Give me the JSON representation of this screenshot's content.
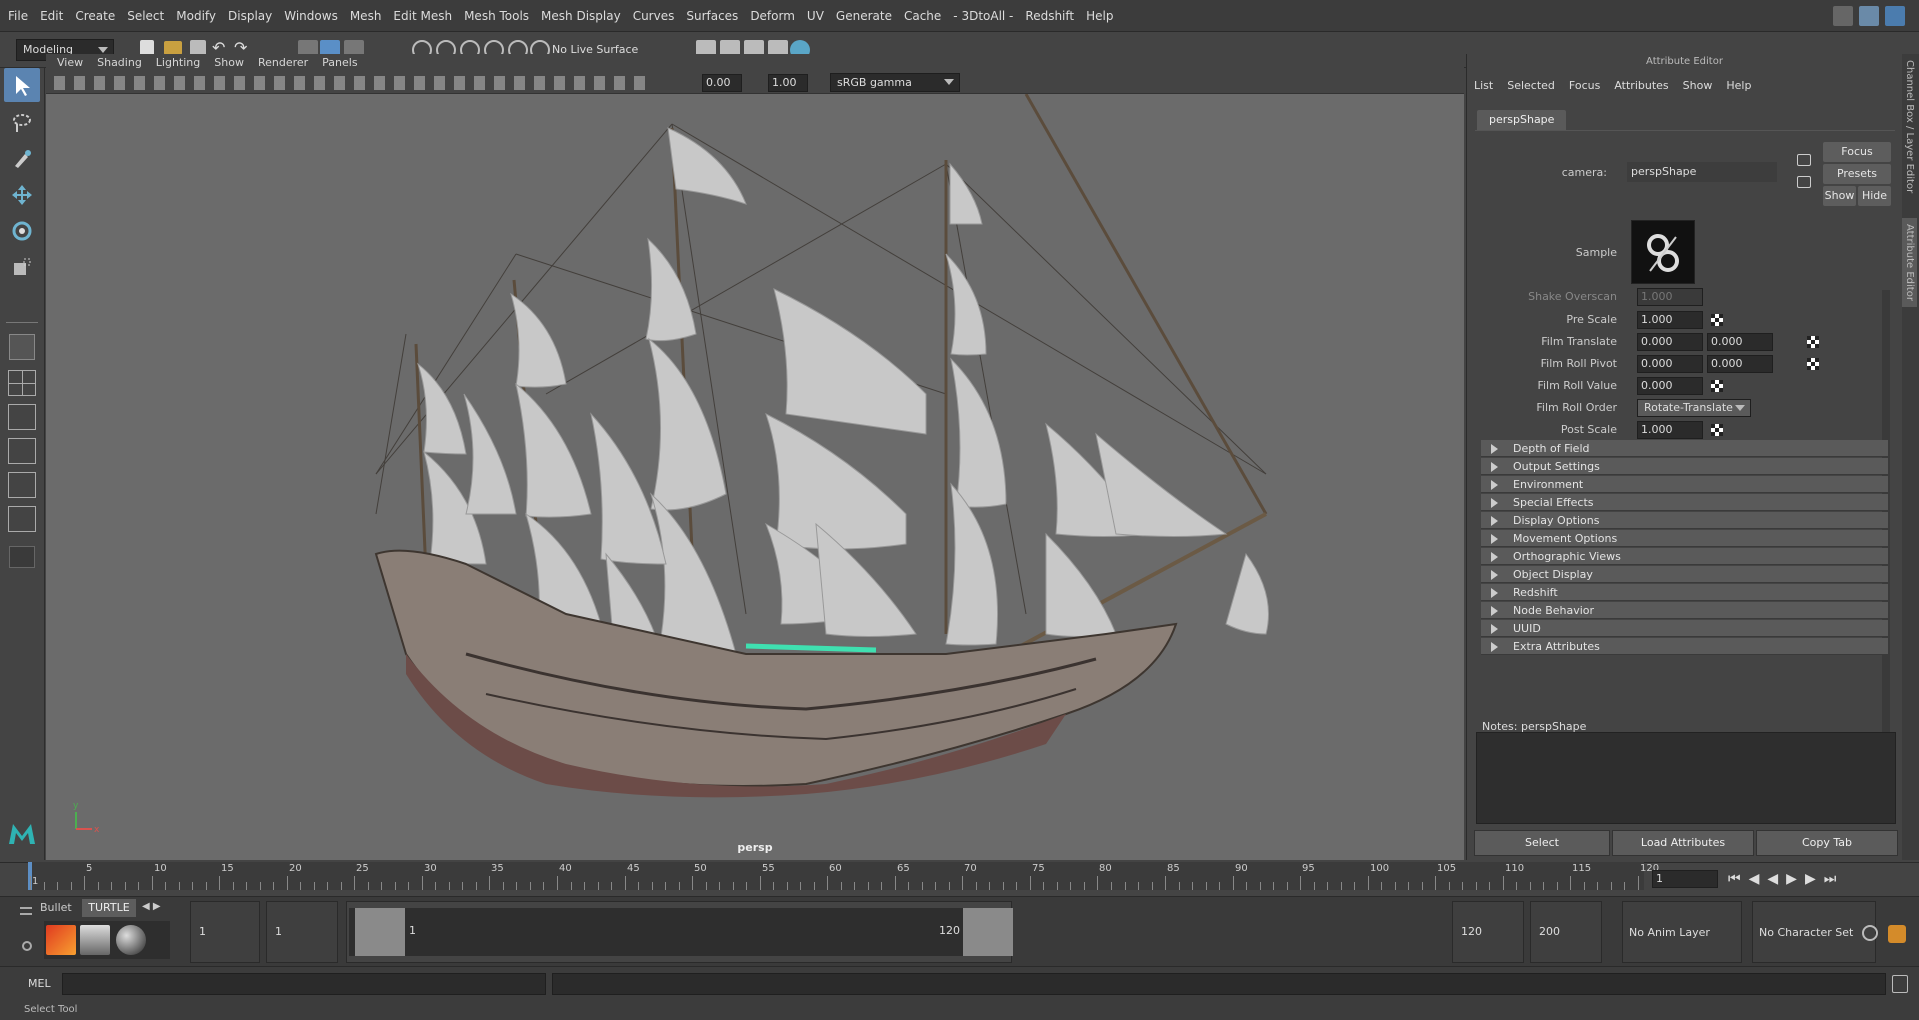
{
  "menubar": {
    "items": [
      "File",
      "Edit",
      "Create",
      "Select",
      "Modify",
      "Display",
      "Windows",
      "Mesh",
      "Edit Mesh",
      "Mesh Tools",
      "Mesh Display",
      "Curves",
      "Surfaces",
      "Deform",
      "UV",
      "Generate",
      "Cache",
      "- 3DtoAll -",
      "Redshift",
      "Help"
    ]
  },
  "shelf": {
    "mode": "Modeling",
    "live_surface": "No Live Surface"
  },
  "viewport": {
    "menus": [
      "View",
      "Shading",
      "Lighting",
      "Show",
      "Renderer",
      "Panels"
    ],
    "field_a": "0.00",
    "field_b": "1.00",
    "colorspace": "sRGB gamma",
    "camera_label": "persp",
    "axis_y": "y",
    "axis_x": "x"
  },
  "attr_editor": {
    "title": "Attribute Editor",
    "menus": [
      "List",
      "Selected",
      "Focus",
      "Attributes",
      "Show",
      "Help"
    ],
    "tab": "perspShape",
    "camera_label": "camera:",
    "camera_value": "perspShape",
    "focus": "Focus",
    "presets": "Presets",
    "show": "Show",
    "hide": "Hide",
    "sample_label": "Sample",
    "shake_overscan_label": "Shake Overscan",
    "shake_overscan": "1.000",
    "pre_scale_label": "Pre Scale",
    "pre_scale": "1.000",
    "film_translate_label": "Film Translate",
    "film_translate_x": "0.000",
    "film_translate_y": "0.000",
    "film_roll_pivot_label": "Film Roll Pivot",
    "film_roll_pivot_x": "0.000",
    "film_roll_pivot_y": "0.000",
    "film_roll_value_label": "Film Roll Value",
    "film_roll_value": "0.000",
    "film_roll_order_label": "Film Roll Order",
    "film_roll_order": "Rotate-Translate",
    "post_scale_label": "Post Scale",
    "post_scale": "1.000",
    "sections": [
      "Depth of Field",
      "Output Settings",
      "Environment",
      "Special Effects",
      "Display Options",
      "Movement Options",
      "Orthographic Views",
      "Object Display",
      "Redshift",
      "Node Behavior",
      "UUID",
      "Extra Attributes"
    ],
    "notes_label": "Notes:  perspShape",
    "buttons": {
      "select": "Select",
      "load": "Load Attributes",
      "copy": "Copy Tab"
    },
    "side_tabs": {
      "channel": "Channel Box / Layer Editor",
      "attr": "Attribute Editor"
    }
  },
  "timeline": {
    "ticks": [
      "1",
      "5",
      "10",
      "15",
      "20",
      "25",
      "30",
      "35",
      "40",
      "45",
      "50",
      "55",
      "60",
      "65",
      "70",
      "75",
      "80",
      "85",
      "90",
      "95",
      "100",
      "105",
      "110",
      "115",
      "120"
    ],
    "current_frame": "1"
  },
  "range": {
    "tab_bullet": "Bullet",
    "tab_turtle": "TURTLE",
    "start": "1",
    "start2": "1",
    "slider_start": "1",
    "slider_end": "120",
    "end": "120",
    "end2": "200",
    "anim_layer": "No Anim Layer",
    "char_set": "No Character Set"
  },
  "cmd": {
    "label": "MEL"
  },
  "status": {
    "text": "Select Tool"
  }
}
